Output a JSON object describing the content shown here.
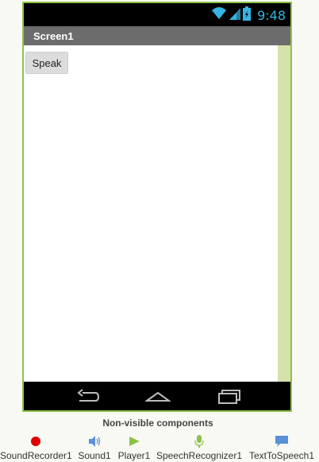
{
  "status_bar": {
    "time": "9:48",
    "icons": [
      "wifi-icon",
      "signal-icon",
      "battery-icon"
    ],
    "icon_color": "#33b5e5"
  },
  "screen": {
    "title": "Screen1"
  },
  "content": {
    "speak_button_label": "Speak"
  },
  "nav_bar": {
    "icons": [
      "back-icon",
      "home-icon",
      "recent-apps-icon"
    ]
  },
  "nonvisible": {
    "title": "Non-visible components",
    "items": [
      {
        "label": "SoundRecorder1",
        "icon": "record-dot-icon"
      },
      {
        "label": "Sound1",
        "icon": "speaker-icon"
      },
      {
        "label": "Player1",
        "icon": "play-icon"
      },
      {
        "label": "SpeechRecognizer1",
        "icon": "microphone-icon"
      },
      {
        "label": "TextToSpeech1",
        "icon": "speech-bubble-icon"
      }
    ]
  },
  "colors": {
    "frame": "#8bc34a",
    "title_bar": "#6c6c6c",
    "scroll_strip": "#d4e2a9",
    "record_red": "#e00000"
  }
}
